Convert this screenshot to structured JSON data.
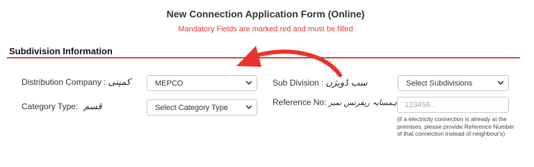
{
  "form": {
    "title": "New Connection Application Form (Online)",
    "mandatory_note": "Mandatory Fields are marked red and must be filled"
  },
  "section": {
    "title": "Subdivision Information"
  },
  "fields": {
    "distribution_company": {
      "label": "Distribution Company :",
      "label_urdu": "کمپنی",
      "value": "MEPCO"
    },
    "category_type": {
      "label": "Category Type:",
      "label_urdu": "قسم",
      "value": "Select Category Type"
    },
    "sub_division": {
      "label": "Sub Division :",
      "label_urdu": "سب ڈویژن",
      "value": "Select Subdivisions"
    },
    "reference_no": {
      "label": "Reference No:",
      "label_urdu": "ہمسایہ ریفرنس نمبر",
      "placeholder": "123456...",
      "hint": "(if a electricity connection is already at the premises, please provide Reference Number of that connection instead of neighbour's)"
    }
  },
  "colors": {
    "accent_red": "#e53935",
    "rule": "#d24a3a",
    "annotation_arrow": "#e8342c"
  },
  "icons": {
    "select_chevron": "chevron-down-icon",
    "annotation": "curved-arrow-annotation"
  }
}
